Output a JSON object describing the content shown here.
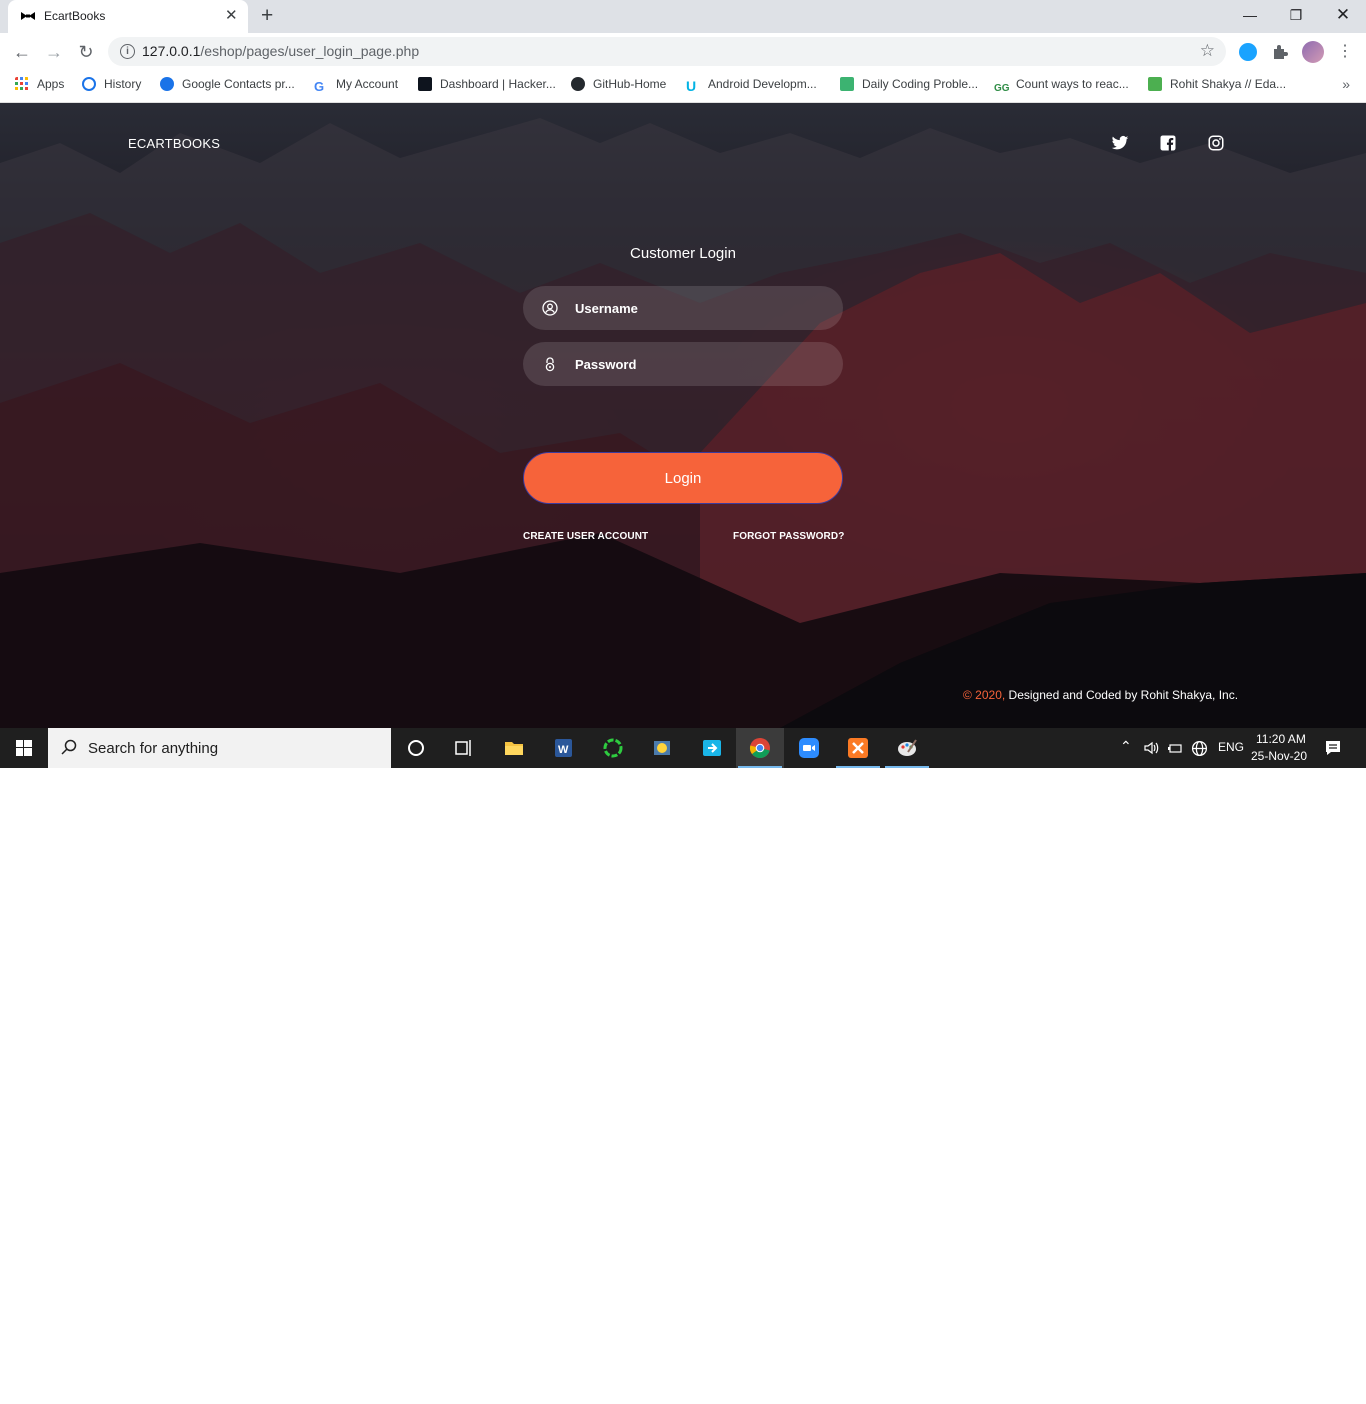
{
  "browser": {
    "tab_title": "EcartBooks",
    "url_host": "127.0.0.1",
    "url_path": "/eshop/pages/user_login_page.php"
  },
  "bookmarks": [
    {
      "label": "Apps",
      "icon": "apps-grid-icon",
      "color": "#ea4335"
    },
    {
      "label": "History",
      "icon": "history-icon",
      "color": "#1a73e8"
    },
    {
      "label": "Google Contacts pr...",
      "icon": "google-contacts-icon",
      "color": "#1a73e8"
    },
    {
      "label": "My Account",
      "icon": "google-g-icon",
      "color": "#4285f4"
    },
    {
      "label": "Dashboard | Hacker...",
      "icon": "hackerrank-icon",
      "color": "#0e141e"
    },
    {
      "label": "GitHub-Home",
      "icon": "github-icon",
      "color": "#24292e"
    },
    {
      "label": "Android Developm...",
      "icon": "udacity-icon",
      "color": "#02b3e4"
    },
    {
      "label": "Daily Coding Proble...",
      "icon": "daily-coding-icon",
      "color": "#3cb371"
    },
    {
      "label": "Count ways to reac...",
      "icon": "geeksforgeeks-icon",
      "color": "#2f8d46"
    },
    {
      "label": "Rohit Shakya // Eda...",
      "icon": "edabit-icon",
      "color": "#4caf50"
    }
  ],
  "site": {
    "brand": "ECARTBOOKS",
    "social": [
      "twitter-icon",
      "facebook-icon",
      "instagram-icon"
    ],
    "login_title": "Customer Login",
    "username_placeholder": "Username",
    "password_placeholder": "Password",
    "login_button": "Login",
    "create_account": "CREATE USER ACCOUNT",
    "forgot_password": "FORGOT PASSWORD?",
    "footer_accent": "© 2020,",
    "footer_text": " Designed and Coded by Rohit Shakya, Inc.",
    "accent_color": "#f6633a"
  },
  "taskbar": {
    "search_placeholder": "Search for anything",
    "apps": [
      "cortana-icon",
      "task-view-icon",
      "file-explorer-icon",
      "word-icon",
      "sync-app-icon",
      "python-icon",
      "sticky-app-icon",
      "chrome-icon",
      "zoom-icon",
      "xampp-icon",
      "paint-icon"
    ],
    "language": "ENG",
    "time": "11:20 AM",
    "date": "25-Nov-20"
  }
}
